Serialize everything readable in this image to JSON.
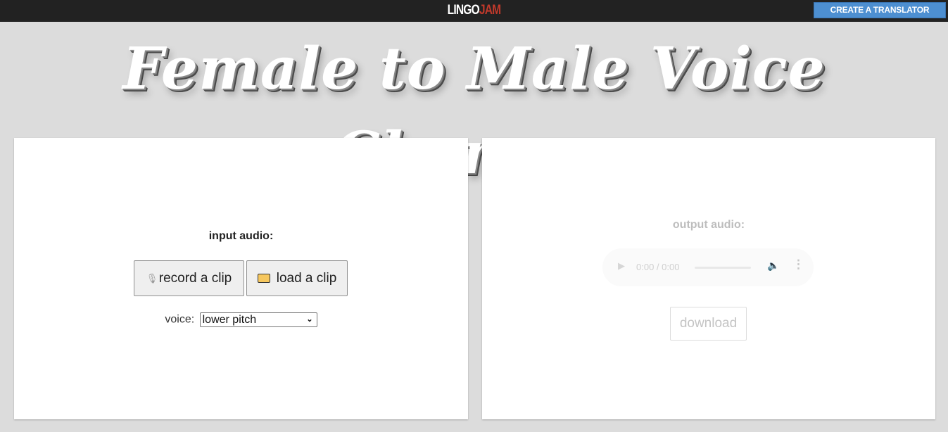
{
  "topbar": {
    "logo": {
      "part1": "LINGO",
      "part2": "JAM"
    },
    "create_button": "CREATE A TRANSLATOR"
  },
  "page_title": "Female to Male Voice Changer",
  "input_panel": {
    "label": "input audio:",
    "record_button": "record a clip",
    "load_button": "load a clip",
    "voice_label": "voice:",
    "voice_selected": "lower pitch",
    "icons": {
      "record": "microphone-icon",
      "load": "folder-icon"
    }
  },
  "output_panel": {
    "label": "output audio:",
    "player": {
      "time": "0:00 / 0:00",
      "icons": [
        "play-icon",
        "volume-icon",
        "more-options-icon"
      ]
    },
    "download_button": "download"
  },
  "colors": {
    "topbar": "#222222",
    "brand_red": "#c0392b",
    "create_button": "#4d8fd1",
    "background": "#dcdcdc"
  }
}
